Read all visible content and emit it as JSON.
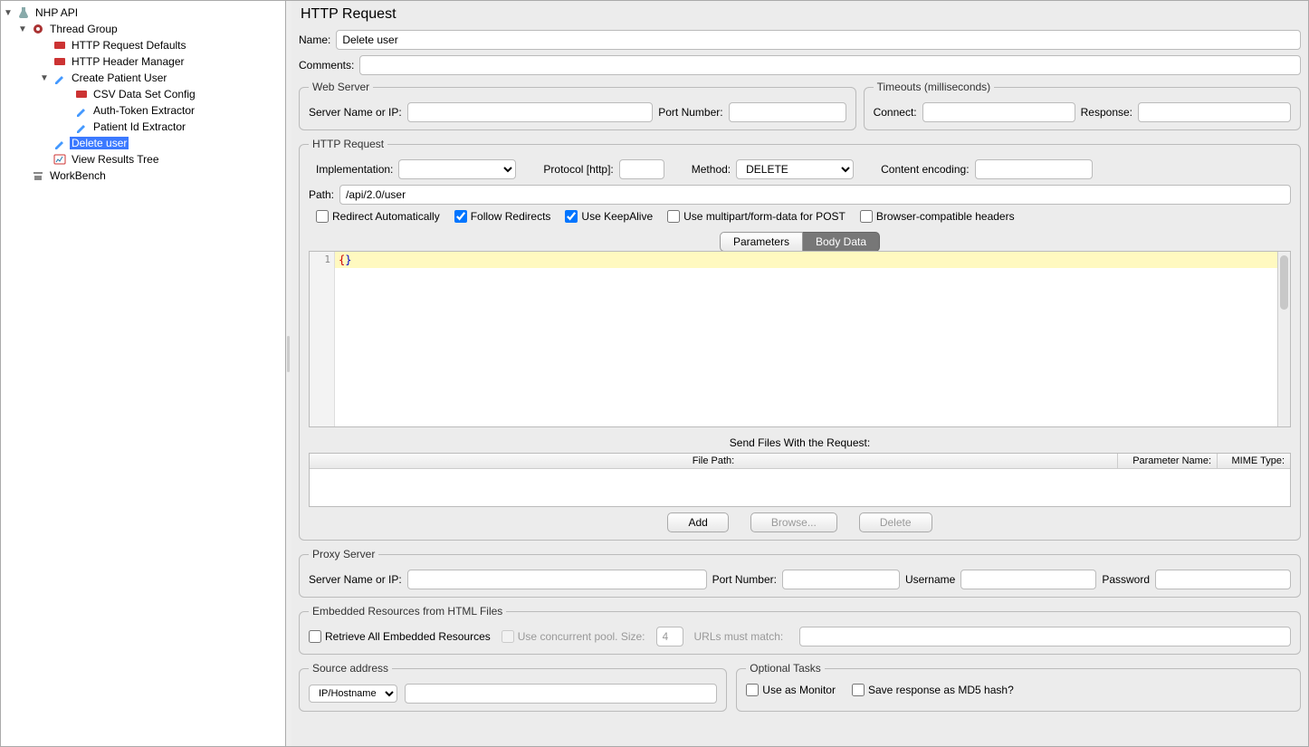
{
  "tree": {
    "root": "NHP API",
    "thread_group": "Thread Group",
    "http_defaults": "HTTP Request Defaults",
    "http_header": "HTTP Header Manager",
    "create_patient": "Create Patient User",
    "csv": "CSV Data Set Config",
    "auth_token": "Auth-Token Extractor",
    "patient_id": "Patient Id Extractor",
    "delete_user": "Delete user",
    "view_results": "View Results Tree",
    "workbench": "WorkBench"
  },
  "panel": {
    "title": "HTTP Request",
    "name_label": "Name:",
    "name_value": "Delete user",
    "comments_label": "Comments:",
    "comments_value": ""
  },
  "webserver": {
    "legend": "Web Server",
    "server_label": "Server Name or IP:",
    "server_value": "",
    "port_label": "Port Number:",
    "port_value": ""
  },
  "timeouts": {
    "legend": "Timeouts (milliseconds)",
    "connect_label": "Connect:",
    "connect_value": "",
    "response_label": "Response:",
    "response_value": ""
  },
  "http": {
    "legend": "HTTP Request",
    "impl_label": "Implementation:",
    "impl_value": "",
    "protocol_label": "Protocol [http]:",
    "protocol_value": "",
    "method_label": "Method:",
    "method_value": "DELETE",
    "encoding_label": "Content encoding:",
    "encoding_value": "",
    "path_label": "Path:",
    "path_value": "/api/2.0/user",
    "chk_redirect_auto": "Redirect Automatically",
    "chk_follow": "Follow Redirects",
    "chk_keepalive": "Use KeepAlive",
    "chk_multipart": "Use multipart/form-data for POST",
    "chk_browser": "Browser-compatible headers",
    "tab_params": "Parameters",
    "tab_body": "Body Data",
    "body_line1": "1",
    "body_code_l": "{",
    "body_code_r": "}"
  },
  "files": {
    "title": "Send Files With the Request:",
    "col_path": "File Path:",
    "col_pname": "Parameter Name:",
    "col_mime": "MIME Type:",
    "btn_add": "Add",
    "btn_browse": "Browse...",
    "btn_delete": "Delete"
  },
  "proxy": {
    "legend": "Proxy Server",
    "server_label": "Server Name or IP:",
    "server_value": "",
    "port_label": "Port Number:",
    "port_value": "",
    "user_label": "Username",
    "user_value": "",
    "pass_label": "Password",
    "pass_value": ""
  },
  "embedded": {
    "legend": "Embedded Resources from HTML Files",
    "retrieve": "Retrieve All Embedded Resources",
    "concurrent": "Use concurrent pool. Size:",
    "pool_value": "4",
    "urls_label": "URLs must match:",
    "urls_value": ""
  },
  "source": {
    "legend": "Source address",
    "type": "IP/Hostname",
    "value": ""
  },
  "optional": {
    "legend": "Optional Tasks",
    "monitor": "Use as Monitor",
    "md5": "Save response as MD5 hash?"
  }
}
